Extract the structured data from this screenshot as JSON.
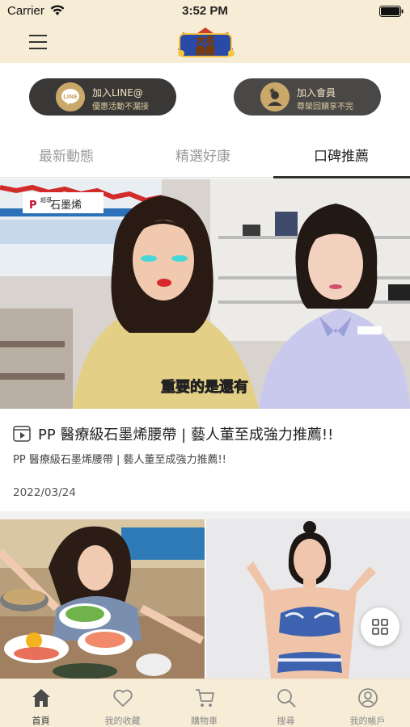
{
  "status_bar": {
    "carrier": "Carrier",
    "time": "3:52 PM"
  },
  "header": {
    "logo_text_line1": "大名",
    "logo_text_line2": "鼎鼎"
  },
  "cta": {
    "line": {
      "title": "加入LINE@",
      "subtitle": "優惠活動不漏接",
      "badge_text": "LINE"
    },
    "member": {
      "title": "加入會員",
      "subtitle": "尊榮回饋享不完"
    }
  },
  "tabs": [
    {
      "label": "最新動態"
    },
    {
      "label": "精選好康"
    },
    {
      "label": "口碑推薦"
    }
  ],
  "active_tab": "口碑推薦",
  "article": {
    "brand_overlay": "石墨烯",
    "brand_small": "超導",
    "caption": "重要的是還有",
    "title": "PP 醫療級石墨烯腰帶 | 藝人董至成強力推薦!!",
    "subtitle": "PP 醫療級石墨烯腰帶 | 藝人董至成強力推薦!!",
    "date": "2022/03/24"
  },
  "bottom_nav": [
    {
      "label": "首頁",
      "icon": "home-icon"
    },
    {
      "label": "我的收藏",
      "icon": "heart-icon"
    },
    {
      "label": "購物車",
      "icon": "cart-icon"
    },
    {
      "label": "搜尋",
      "icon": "search-icon"
    },
    {
      "label": "我的帳戶",
      "icon": "account-icon"
    }
  ],
  "colors": {
    "header_bg": "#f7ecd6",
    "cta_bg": "#3a3836",
    "accent_gold": "#c9a86a"
  }
}
